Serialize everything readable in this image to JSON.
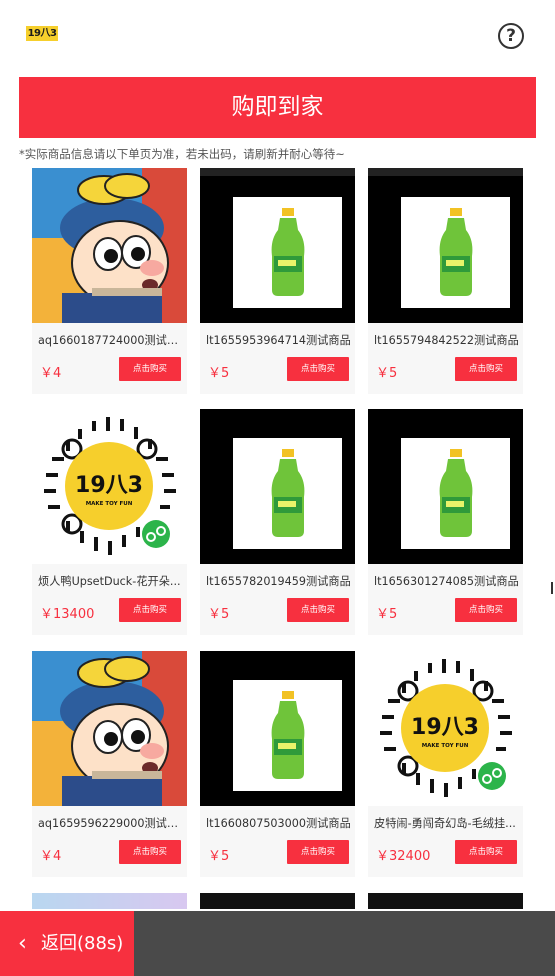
{
  "header": {
    "logo_text": "19八3",
    "help_icon": "question-circle-icon"
  },
  "banner": {
    "title": "购即到家"
  },
  "notice": "*实际商品信息请以下单页为准，若未出码，请刷新并耐心等待~",
  "products": [
    {
      "name": "aq1660187724000测试商品",
      "price": "￥4",
      "buy_label": "点击购买",
      "image": "cartoon-boy"
    },
    {
      "name": "lt1655953964714测试商品",
      "price": "￥5",
      "buy_label": "点击购买",
      "image": "soda-bottle"
    },
    {
      "name": "lt1655794842522测试商品",
      "price": "￥5",
      "buy_label": "点击购买",
      "image": "soda-bottle"
    },
    {
      "name": "烦人鸭UpsetDuck-花开朵...",
      "price": "￥13400",
      "buy_label": "点击购买",
      "image": "mini-program-code"
    },
    {
      "name": "lt1655782019459测试商品",
      "price": "￥5",
      "buy_label": "点击购买",
      "image": "soda-bottle"
    },
    {
      "name": "lt1656301274085测试商品",
      "price": "￥5",
      "buy_label": "点击购买",
      "image": "soda-bottle"
    },
    {
      "name": "aq1659596229000测试商品",
      "price": "￥4",
      "buy_label": "点击购买",
      "image": "cartoon-boy"
    },
    {
      "name": "lt1660807503000测试商品",
      "price": "￥5",
      "buy_label": "点击购买",
      "image": "soda-bottle"
    },
    {
      "name": "皮特闹-勇闯奇幻岛-毛绒挂...",
      "price": "￥32400",
      "buy_label": "点击购买",
      "image": "mini-program-code"
    }
  ],
  "qr_code": {
    "brand": "19八3",
    "tagline": "MAKE TOY FUN"
  },
  "footer": {
    "back_label": "返回(88s)",
    "back_icon": "chevron-left-icon"
  },
  "colors": {
    "accent": "#f7303f",
    "footer_bg": "#4a4a4a",
    "logo_bg": "#f6cf2c"
  }
}
